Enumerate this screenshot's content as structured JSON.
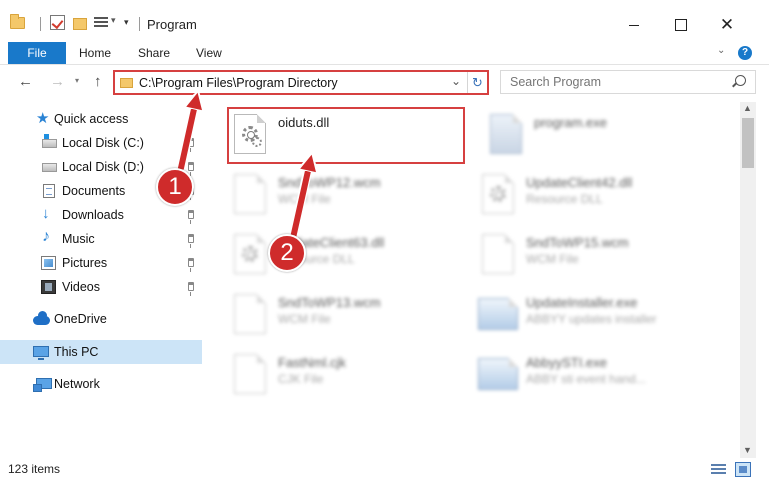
{
  "window": {
    "title": "Program",
    "close_glyph": "✕"
  },
  "ribbon": {
    "tabs": [
      "File",
      "Home",
      "Share",
      "View"
    ],
    "help": "?"
  },
  "address": {
    "path": "C:\\Program Files\\Program Directory",
    "refresh_glyph": "↻"
  },
  "search": {
    "placeholder": "Search Program"
  },
  "sidebar": {
    "items": [
      {
        "label": "Quick access",
        "icon": "star-icon",
        "pinned": false
      },
      {
        "label": "Local Disk (C:)",
        "icon": "drive-icon",
        "pinned": true
      },
      {
        "label": "Local Disk (D:)",
        "icon": "drive-icon",
        "pinned": true
      },
      {
        "label": "Documents",
        "icon": "documents-icon",
        "pinned": true
      },
      {
        "label": "Downloads",
        "icon": "download-icon",
        "pinned": true
      },
      {
        "label": "Music",
        "icon": "music-icon",
        "pinned": true
      },
      {
        "label": "Pictures",
        "icon": "pictures-icon",
        "pinned": true
      },
      {
        "label": "Videos",
        "icon": "videos-icon",
        "pinned": true
      },
      {
        "label": "OneDrive",
        "icon": "cloud-icon",
        "pinned": false
      },
      {
        "label": "This PC",
        "icon": "computer-icon",
        "pinned": false,
        "selected": true
      },
      {
        "label": "Network",
        "icon": "network-icon",
        "pinned": false
      }
    ]
  },
  "files": [
    {
      "name": "oiduts.dll",
      "type": "",
      "icon": "dll-gear-icon"
    },
    {
      "name": "program.exe",
      "type": "",
      "icon": "app-icon"
    },
    {
      "name": "SndToWP12.wcm",
      "type": "WCM File",
      "icon": "file-icon"
    },
    {
      "name": "UpdateClient42.dll",
      "type": "Resource DLL",
      "icon": "dll-gear-icon"
    },
    {
      "name": "UpdateClient63.dll",
      "type": "Resource DLL",
      "icon": "dll-gear-icon"
    },
    {
      "name": "SndToWP15.wcm",
      "type": "WCM File",
      "icon": "file-icon"
    },
    {
      "name": "SndToWP13.wcm",
      "type": "WCM File",
      "icon": "file-icon"
    },
    {
      "name": "UpdateInstaller.exe",
      "type": "ABBYY updates installer",
      "icon": "installer-icon"
    },
    {
      "name": "FastNml.cjk",
      "type": "CJK File",
      "icon": "file-icon"
    },
    {
      "name": "AbbyySTI.exe",
      "type": "ABBY sti event hand...",
      "icon": "installer-icon"
    }
  ],
  "status": {
    "count": "123 items"
  },
  "annotations": {
    "step1": "1",
    "step2": "2",
    "color": "#cf2b2b"
  }
}
